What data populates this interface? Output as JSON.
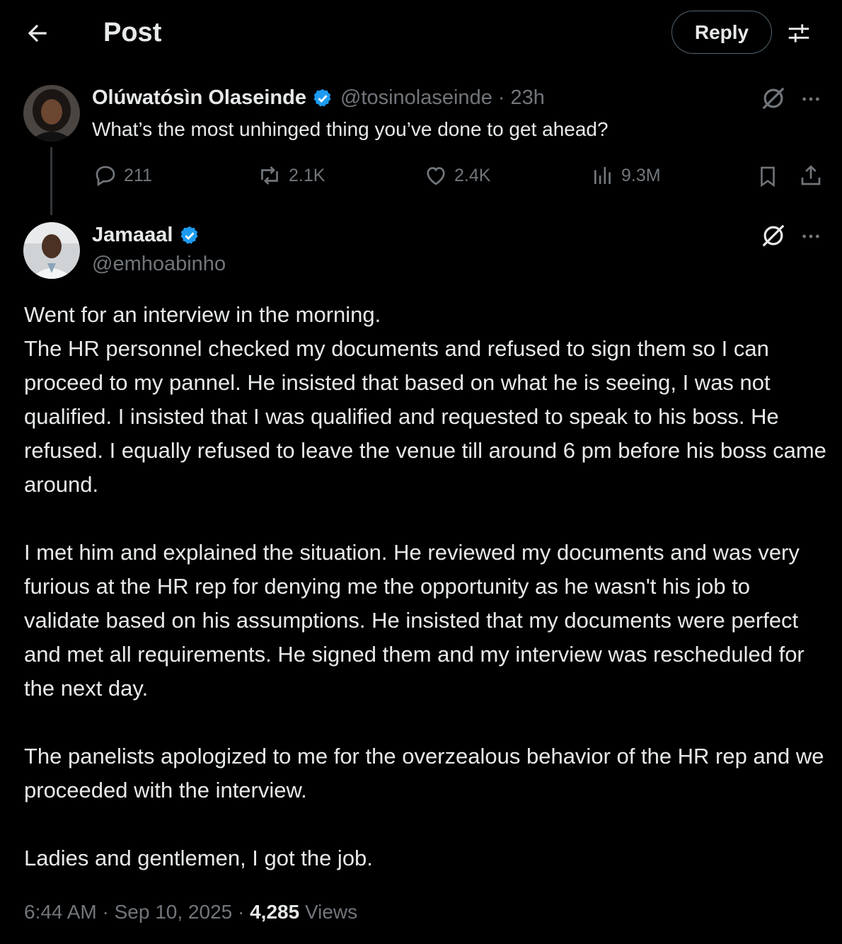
{
  "header": {
    "title": "Post",
    "reply_label": "Reply"
  },
  "original_post": {
    "author_name": "Olúwatósìn Olaseinde",
    "handle": "@tosinolaseinde",
    "separator": "·",
    "time": "23h",
    "text": "What’s the most unhinged thing you’ve done to get ahead?",
    "stats": {
      "replies": "211",
      "reposts": "2.1K",
      "likes": "2.4K",
      "views": "9.3M"
    }
  },
  "reply_post": {
    "author_name": "Jamaaal",
    "handle": "@emhoabinho",
    "paragraphs": [
      "Went for an interview in the morning.\nThe HR personnel checked my documents and refused to sign them so I can proceed to my pannel. He insisted that based on what he is seeing, I was not qualified. I insisted that I was qualified and requested to speak to his boss. He refused. I equally refused to leave the venue till around 6 pm before his boss came around.",
      "I met him and explained the situation. He reviewed my documents and was very furious at the HR rep for denying me the opportunity as he wasn't his job to validate based on his assumptions. He insisted that my documents were perfect and met all requirements. He signed them and my interview was rescheduled for the next day.",
      "The panelists apologized to me for the overzealous behavior of the HR rep and we proceeded with the interview.",
      "Ladies and gentlemen, I got the job."
    ],
    "time": "6:44 AM",
    "date": "Sep 10, 2025",
    "views_count": "4,285",
    "views_label": "Views",
    "separator": "·"
  },
  "colors": {
    "background": "#000000",
    "text": "#e7e9ea",
    "muted": "#71767b",
    "verified": "#1d9bf0",
    "border": "#536471"
  }
}
